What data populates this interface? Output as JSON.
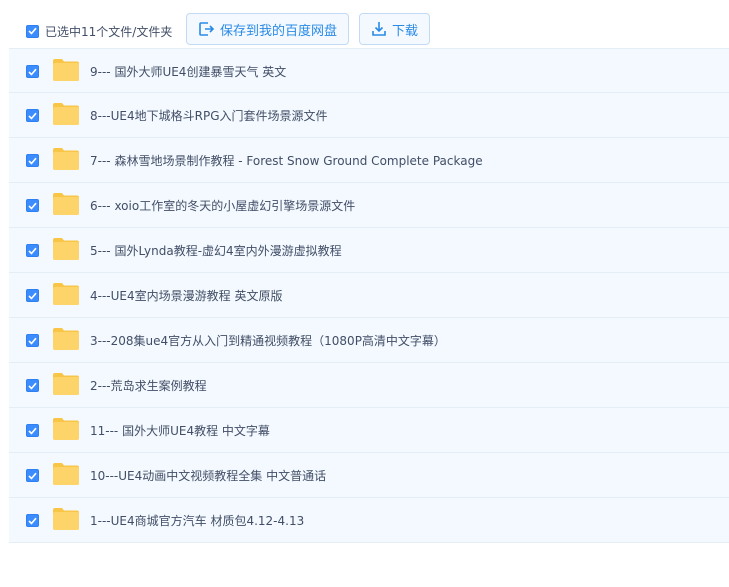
{
  "toolbar": {
    "select_all_label": "已选中11个文件/文件夹",
    "save_label": "保存到我的百度网盘",
    "download_label": "下载"
  },
  "colors": {
    "accent": "#2a8ae6",
    "checkbox": "#3b8cff",
    "folder": "#fdd164",
    "row_bg": "#f3f9fe"
  },
  "files": [
    {
      "name": "9--- 国外大师UE4创建暴雪天气 英文",
      "icon": "folder-icon",
      "checked": true
    },
    {
      "name": "8---UE4地下城格斗RPG入门套件场景源文件",
      "icon": "folder-icon",
      "checked": true
    },
    {
      "name": "7--- 森林雪地场景制作教程 - Forest Snow Ground Complete Package",
      "icon": "folder-icon",
      "checked": true
    },
    {
      "name": "6--- xoio工作室的冬天的小屋虚幻引擎场景源文件",
      "icon": "folder-icon",
      "checked": true
    },
    {
      "name": "5--- 国外Lynda教程-虚幻4室内外漫游虚拟教程",
      "icon": "folder-icon",
      "checked": true
    },
    {
      "name": "4---UE4室内场景漫游教程 英文原版",
      "icon": "folder-icon",
      "checked": true
    },
    {
      "name": "3---208集ue4官方从入门到精通视频教程（1080P高清中文字幕）",
      "icon": "folder-icon",
      "checked": true
    },
    {
      "name": "2---荒岛求生案例教程",
      "icon": "folder-icon",
      "checked": true
    },
    {
      "name": "11--- 国外大师UE4教程 中文字幕",
      "icon": "folder-icon",
      "checked": true
    },
    {
      "name": "10---UE4动画中文视频教程全集 中文普通话",
      "icon": "folder-icon",
      "checked": true
    },
    {
      "name": "1---UE4商城官方汽车 材质包4.12-4.13",
      "icon": "folder-icon",
      "checked": true
    }
  ]
}
